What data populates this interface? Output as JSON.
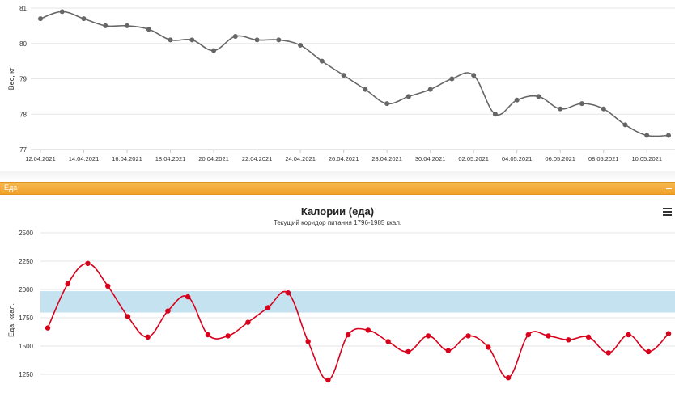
{
  "weight": {
    "chart_data": {
      "type": "line",
      "ylabel": "Вес, кг",
      "ylim": [
        77,
        81
      ],
      "yticks": [
        77,
        78,
        79,
        80,
        81
      ],
      "xticks": [
        "12.04.2021",
        "14.04.2021",
        "16.04.2021",
        "18.04.2021",
        "20.04.2021",
        "22.04.2021",
        "24.04.2021",
        "26.04.2021",
        "28.04.2021",
        "30.04.2021",
        "02.05.2021",
        "04.05.2021",
        "06.05.2021",
        "08.05.2021",
        "10.05.2021"
      ],
      "values": [
        80.7,
        80.9,
        80.7,
        80.5,
        80.5,
        80.4,
        80.1,
        80.1,
        79.8,
        80.2,
        80.1,
        80.1,
        79.95,
        79.5,
        79.1,
        78.7,
        78.3,
        78.5,
        78.7,
        79.0,
        79.1,
        78.0,
        78.4,
        78.5,
        78.15,
        78.3,
        78.15,
        77.7,
        77.4,
        77.4
      ],
      "color": "#666666"
    }
  },
  "section": {
    "title": "Еда"
  },
  "calories": {
    "title": "Калории (еда)",
    "subtitle": "Текущий коридор питания 1796-1985 ккал.",
    "menu_icon": "hamburger-icon",
    "chart_data": {
      "type": "line",
      "ylabel": "Еда, ккал.",
      "yticks": [
        1250,
        1500,
        1750,
        2000,
        2250,
        2500
      ],
      "band": [
        1796,
        1985
      ],
      "band_color": "#c5e2f1",
      "values": [
        1660,
        2050,
        2230,
        2030,
        1760,
        1580,
        1810,
        1935,
        1600,
        1590,
        1710,
        1840,
        1970,
        1540,
        1200,
        1600,
        1640,
        1540,
        1450,
        1590,
        1460,
        1590,
        1490,
        1220,
        1600,
        1590,
        1555,
        1580,
        1440,
        1600,
        1450,
        1610
      ],
      "color": "#d9001b"
    }
  }
}
